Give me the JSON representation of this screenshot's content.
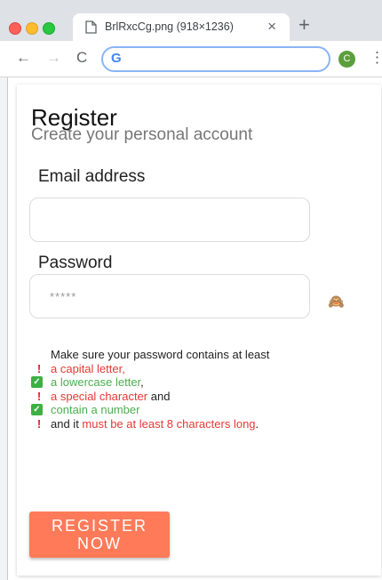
{
  "browser": {
    "tab_title": "BrlRxcCg.png (918×1236)",
    "close_glyph": "×",
    "new_tab_glyph": "+",
    "back_glyph": "←",
    "forward_glyph": "→",
    "reload_glyph": "C",
    "omnibox_icon": "G",
    "avatar_letter": "C",
    "menu_glyph": "⋮"
  },
  "form": {
    "title": "Register",
    "subtitle": "Create your personal account",
    "email_label": "Email address",
    "email_value": "",
    "password_label": "Password",
    "password_placeholder": "*****",
    "reveal_icon": "🙈",
    "rules_intro": "Make sure your password contains at least",
    "rules": [
      {
        "prefix": "",
        "text": "a capital letter,",
        "suffix": "",
        "met": false
      },
      {
        "prefix": "",
        "text": "a lowercase letter",
        "suffix": ",",
        "met": true
      },
      {
        "prefix": "",
        "text": "a special character",
        "suffix": " and",
        "met": false
      },
      {
        "prefix": "",
        "text": "contain a number",
        "suffix": "",
        "met": true
      },
      {
        "prefix": "and it ",
        "text": "must be at least 8 characters long",
        "suffix": ".",
        "met": false
      }
    ],
    "unmet_glyph": "!",
    "met_glyph": "✓",
    "submit_label": "REGISTER\nNOW"
  },
  "colors": {
    "accent": "#ff7a59",
    "unmet": "#e53935",
    "met": "#4caf50"
  }
}
